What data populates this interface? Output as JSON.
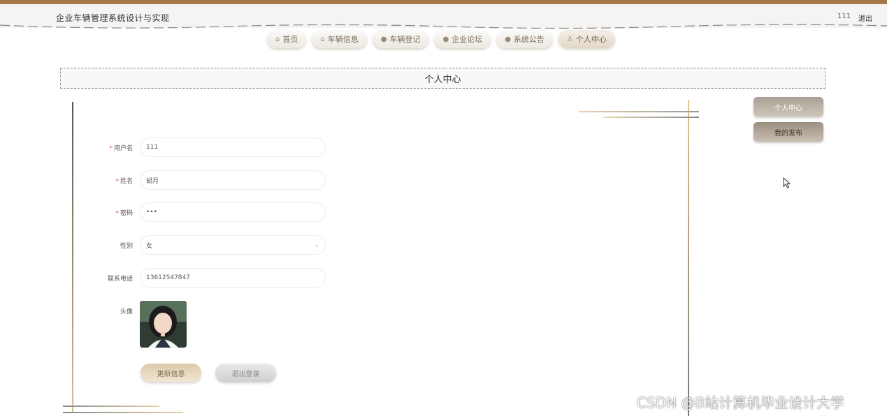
{
  "header": {
    "app_title": "企业车辆管理系统设计与实现",
    "user_name": "111",
    "logout_label": "退出"
  },
  "nav": {
    "items": [
      {
        "label": "首页",
        "icon": "home-icon"
      },
      {
        "label": "车辆信息",
        "icon": "home-icon"
      },
      {
        "label": "车辆登记",
        "icon": "info-icon"
      },
      {
        "label": "企业论坛",
        "icon": "question-icon"
      },
      {
        "label": "系统公告",
        "icon": "info-icon"
      },
      {
        "label": "个人中心",
        "icon": "user-icon"
      }
    ],
    "active_index": 5
  },
  "section_title": "个人中心",
  "form": {
    "username": {
      "label": "用户名",
      "value": "111",
      "required": true
    },
    "name": {
      "label": "姓名",
      "value": "胡月",
      "required": true
    },
    "password": {
      "label": "密码",
      "value": "•••",
      "required": true
    },
    "gender": {
      "label": "性别",
      "value": "女",
      "required": false
    },
    "phone": {
      "label": "联系电话",
      "value": "13612547847",
      "required": false
    },
    "avatar": {
      "label": "头像"
    }
  },
  "buttons": {
    "update": "更新信息",
    "logout": "退出登录"
  },
  "side_menu": {
    "items": [
      "个人中心",
      "我的发布"
    ]
  },
  "watermark": "CSDN @B站计算机毕业设计大学",
  "colors": {
    "accent": "#a57a48",
    "required": "#e05050"
  }
}
